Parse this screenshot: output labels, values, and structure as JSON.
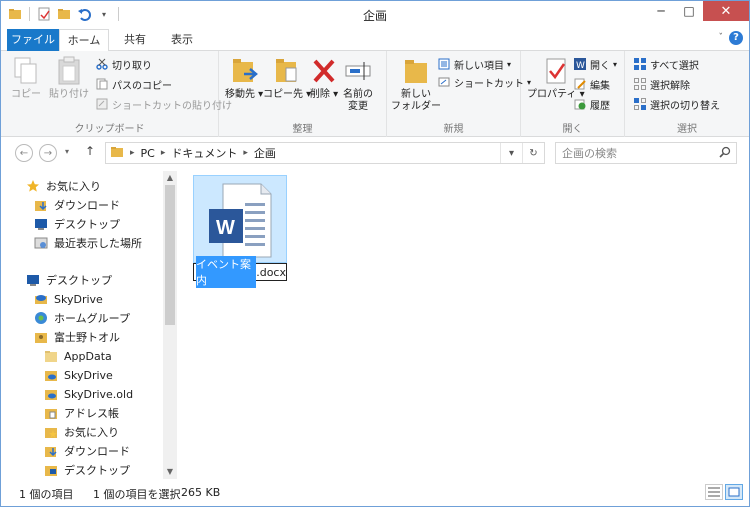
{
  "window": {
    "title": "企画"
  },
  "ribbon_tabs": {
    "file": "ファイル",
    "home": "ホーム",
    "share": "共有",
    "view": "表示"
  },
  "clipboard": {
    "copy": "コピー",
    "paste": "貼り付け",
    "cut": "切り取り",
    "copy_path": "パスのコピー",
    "paste_shortcut": "ショートカットの貼り付け",
    "label": "クリップボード"
  },
  "organize": {
    "move_to": "移動先",
    "copy_to": "コピー先",
    "delete": "削除",
    "rename_line1": "名前の",
    "rename_line2": "変更",
    "label": "整理"
  },
  "new_group": {
    "new_folder_line1": "新しい",
    "new_folder_line2": "フォルダー",
    "new_item": "新しい項目",
    "easy_access": "ショートカット",
    "label": "新規"
  },
  "open_group": {
    "properties": "プロパティ",
    "open": "開く",
    "edit": "編集",
    "history": "履歴",
    "label": "開く"
  },
  "select_group": {
    "select_all": "すべて選択",
    "select_none": "選択解除",
    "invert": "選択の切り替え",
    "label": "選択"
  },
  "address": {
    "pc": "PC",
    "documents": "ドキュメント",
    "folder": "企画"
  },
  "search": {
    "placeholder": "企画の検索"
  },
  "nav_tree": {
    "favorites": "お気に入り",
    "downloads": "ダウンロード",
    "desktop": "デスクトップ",
    "recent": "最近表示した場所",
    "desktop2": "デスクトップ",
    "skydrive": "SkyDrive",
    "homegroup": "ホームグループ",
    "user": "富士野トオル",
    "appdata": "AppData",
    "skydrive2": "SkyDrive",
    "skydrive_old": "SkyDrive.old",
    "contacts": "アドレス帳",
    "favorites2": "お気に入り",
    "downloads2": "ダウンロード",
    "desktop3": "デスクトップ"
  },
  "file": {
    "name_selected": "イベント案内",
    "extension": ".docx",
    "icon_letter": "W"
  },
  "status": {
    "count": "1 個の項目",
    "selected": "1 個の項目を選択",
    "size": "265 KB"
  },
  "colors": {
    "accent": "#1979ca",
    "selection": "#cce8ff",
    "word_blue": "#2b579a"
  }
}
